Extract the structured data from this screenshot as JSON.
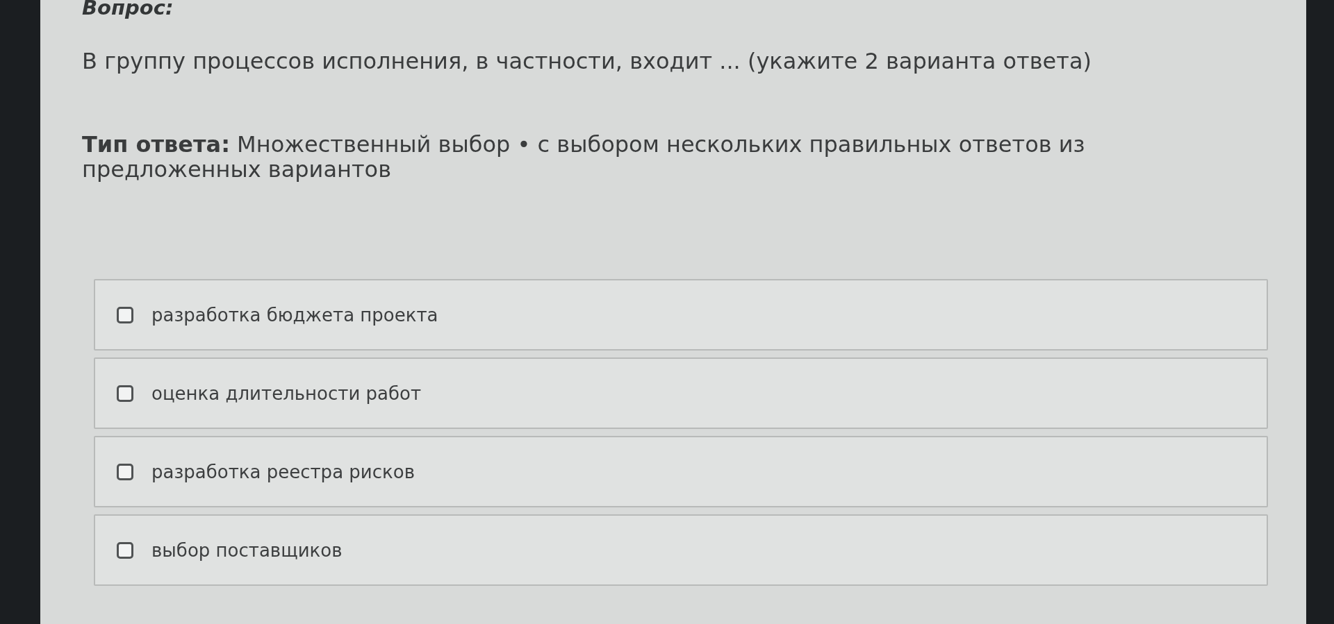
{
  "question": {
    "heading": "Вопрос:",
    "text": "В группу процессов исполнения, в частности, входит ... (укажите 2 варианта ответа)"
  },
  "answer_type": "**Тип ответа:** Множественный выбор • с выбором нескольких правильных ответов из предложенных вариантов",
  "options": [
    {
      "label": "разработка бюджета проекта",
      "checked": false
    },
    {
      "label": "оценка длительности работ",
      "checked": false
    },
    {
      "label": "разработка реестра рисков",
      "checked": false
    },
    {
      "label": "выбор поставщиков",
      "checked": false
    }
  ]
}
